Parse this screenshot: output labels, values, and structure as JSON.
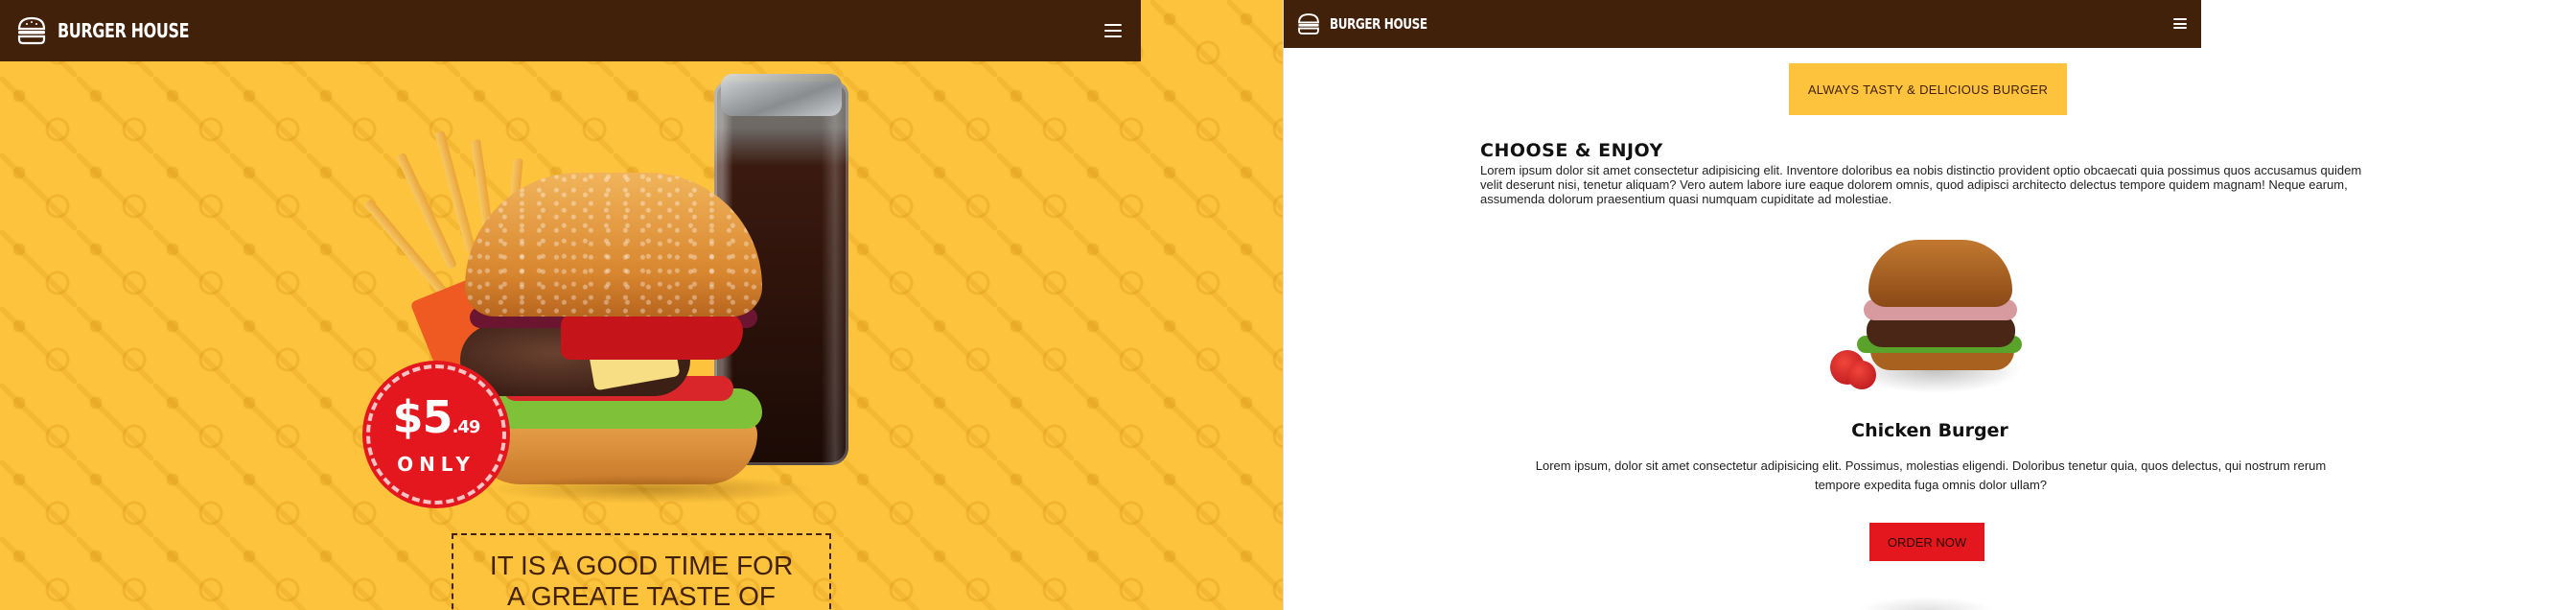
{
  "brand": {
    "name": "BURGER HOUSE"
  },
  "left_view": {
    "price": {
      "dollars": "$5",
      "cents": ".49",
      "label": "ONLY"
    },
    "tagline": {
      "line1": "IT IS A GOOD TIME FOR",
      "line2": "A GREATE TASTE OF"
    }
  },
  "right_view": {
    "promo_label": "ALWAYS TASTY & DELICIOUS BURGER",
    "section": {
      "title": "CHOOSE & ENJOY",
      "body": "Lorem ipsum dolor sit amet consectetur adipisicing elit. Inventore doloribus ea nobis distinctio provident optio obcaecati quia possimus quos accusamus quidem velit deserunt nisi, tenetur aliquam? Vero autem labore iure eaque dolorem omnis, quod adipisci architecto delectus tempore quidem magnam! Neque earum, assumenda dolorum praesentium quasi numquam cupiditate ad molestiae."
    },
    "product": {
      "name": "Chicken Burger",
      "description": "Lorem ipsum, dolor sit amet consectetur adipisicing elit. Possimus, molestias eligendi. Doloribus tenetur quia, quos delectus, qui nostrum rerum tempore expedita fuga omnis dolor ullam?",
      "cta_label": "ORDER NOW"
    }
  },
  "icons": {
    "logo": "burger-logo-icon",
    "menu": "hamburger-menu-icon"
  },
  "colors": {
    "nav_bg": "#42210b",
    "accent_yellow": "#fdc33c",
    "accent_red": "#e3171d"
  }
}
